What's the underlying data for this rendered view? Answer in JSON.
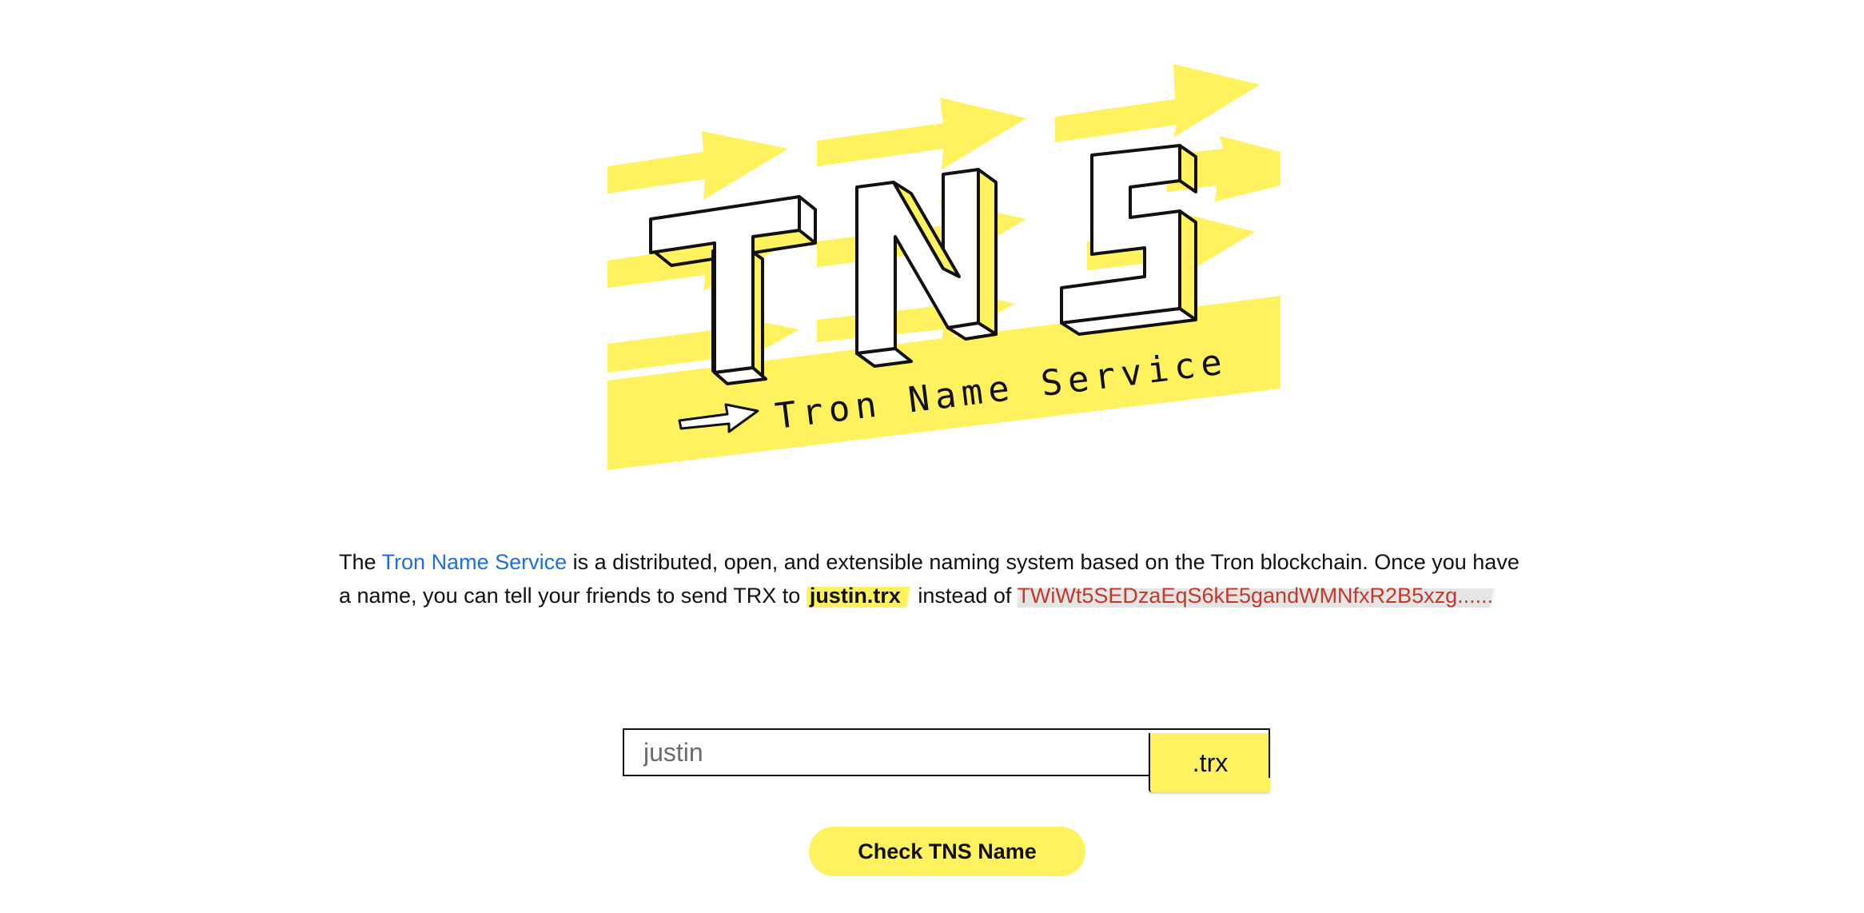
{
  "logo": {
    "letters": "TNS",
    "tagline": "Tron Name Service",
    "accent_color": "#fff25e",
    "outline_color": "#111111"
  },
  "intro": {
    "prefix": "The ",
    "link_text": "Tron Name Service",
    "middle": " is a distributed, open, and extensible naming system based on the Tron blockchain. Once you have a name, you can tell your friends to send TRX to ",
    "example_name": "justin.trx",
    "instead_of": " instead of ",
    "address": "TWiWt5SEDzaEqS6kE5gandWMNfxR2B5xzg......"
  },
  "search": {
    "placeholder": "justin",
    "value": "",
    "suffix": ".trx"
  },
  "actions": {
    "check_label": "Check TNS Name"
  },
  "colors": {
    "link": "#1f6fe0",
    "address": "#c0392b",
    "highlight": "#fff25e"
  }
}
